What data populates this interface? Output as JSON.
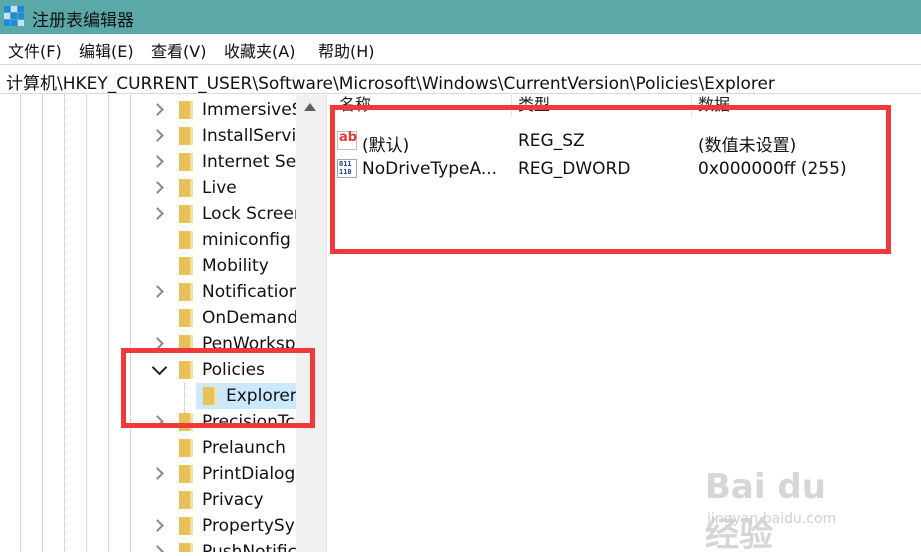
{
  "window": {
    "title": "注册表编辑器"
  },
  "menu": [
    "文件(F)",
    "编辑(E)",
    "查看(V)",
    "收藏夹(A)",
    "帮助(H)"
  ],
  "address": "计算机\\HKEY_CURRENT_USER\\Software\\Microsoft\\Windows\\CurrentVersion\\Policies\\Explorer",
  "tree": {
    "items": [
      {
        "label": "ImmersiveS",
        "expandable": true
      },
      {
        "label": "InstallServic",
        "expandable": true
      },
      {
        "label": "Internet Se",
        "expandable": true
      },
      {
        "label": "Live",
        "expandable": true
      },
      {
        "label": "Lock Screer",
        "expandable": true
      },
      {
        "label": "miniconfig",
        "expandable": false
      },
      {
        "label": "Mobility",
        "expandable": false
      },
      {
        "label": "Notification",
        "expandable": true
      },
      {
        "label": "OnDemand",
        "expandable": false
      },
      {
        "label": "PenWorksp",
        "expandable": true
      },
      {
        "label": "Policies",
        "expanded": true
      },
      {
        "label": "Explorer",
        "selected": true
      },
      {
        "label": "PrecisionTc",
        "expandable": true
      },
      {
        "label": "Prelaunch",
        "expandable": false
      },
      {
        "label": "PrintDialog",
        "expandable": true
      },
      {
        "label": "Privacy",
        "expandable": false
      },
      {
        "label": "PropertySy",
        "expandable": true
      },
      {
        "label": "PushNotific",
        "expandable": true
      }
    ]
  },
  "values_pane": {
    "headers": [
      "名称",
      "类型",
      "数据"
    ],
    "rows": [
      {
        "icon": "string-value-icon",
        "name": "(默认)",
        "type": "REG_SZ",
        "data": "(数值未设置)"
      },
      {
        "icon": "binary-value-icon",
        "name": "NoDriveTypeA...",
        "type": "REG_DWORD",
        "data": "0x000000ff (255)"
      }
    ]
  },
  "annotation_color": "#f0393b",
  "watermark": {
    "logo": "Bai du 经验",
    "url": "jingyan.baidu.com"
  }
}
